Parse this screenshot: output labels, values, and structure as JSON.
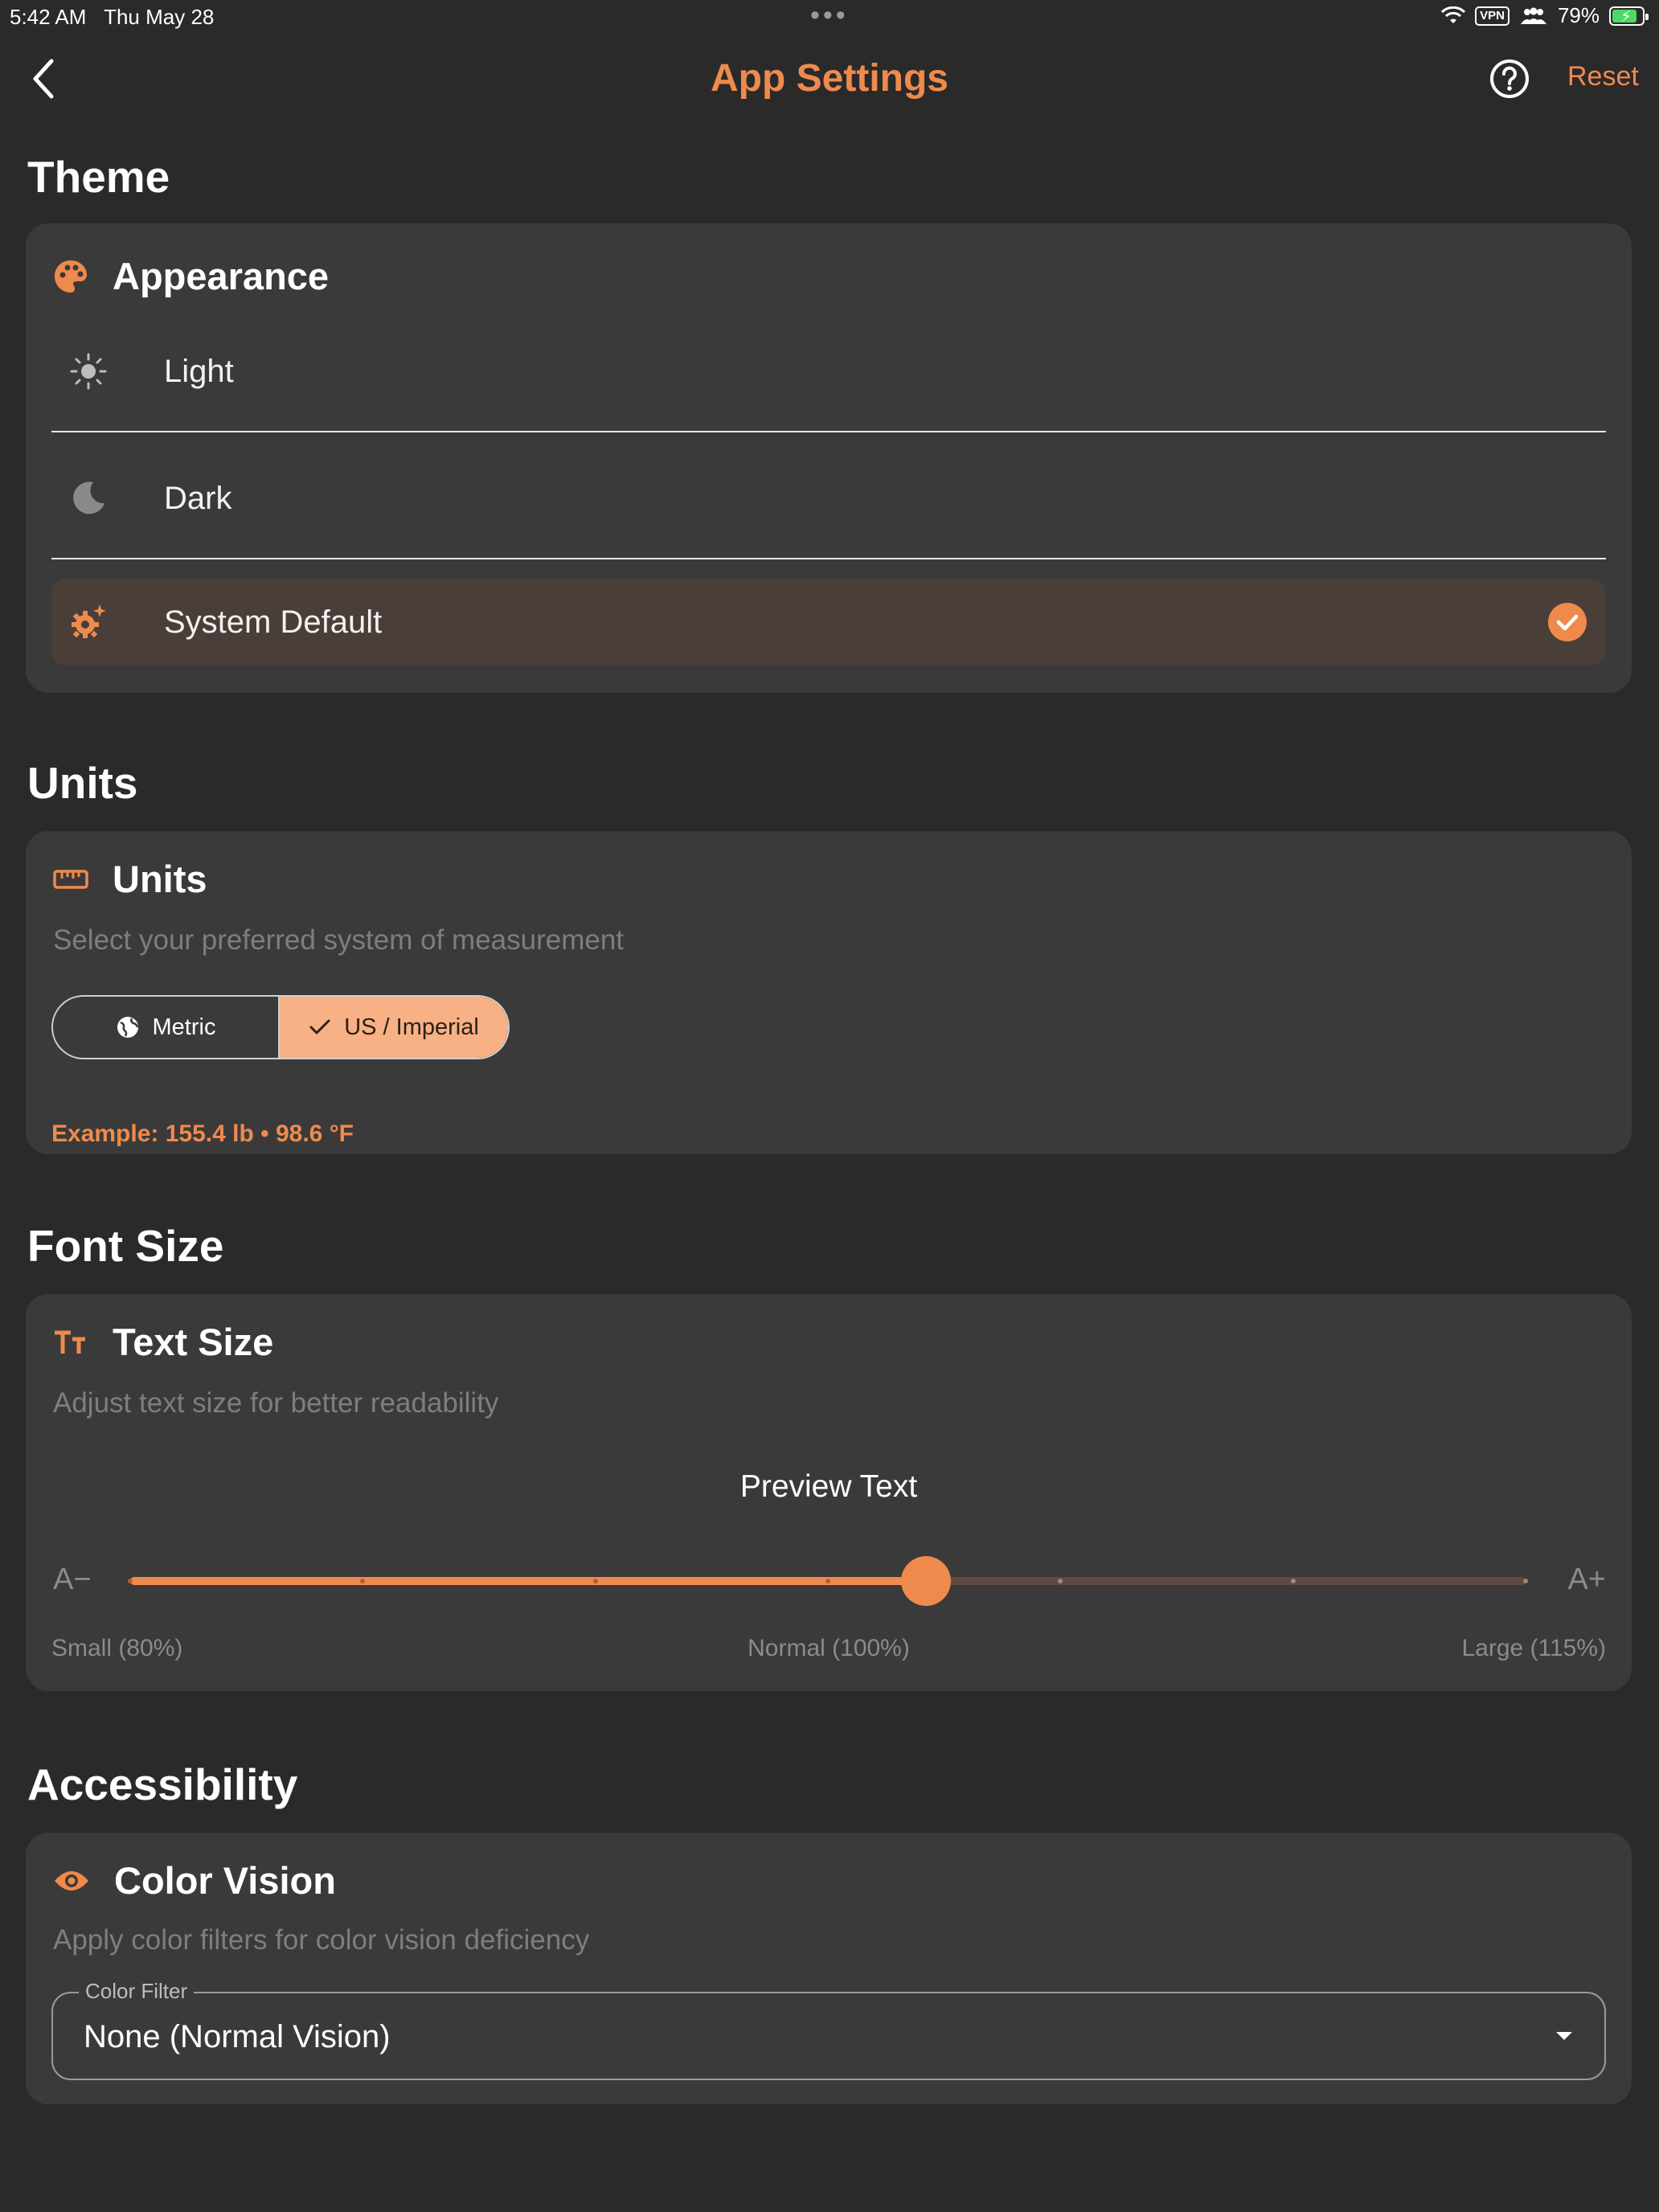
{
  "status_bar": {
    "time": "5:42 AM",
    "date": "Thu May 28",
    "dots": "•••",
    "vpn": "VPN",
    "battery": "79%"
  },
  "nav": {
    "title": "App Settings",
    "reset_label": "Reset",
    "icons": {
      "back": "chevron-left-icon",
      "help": "question-circle-icon"
    }
  },
  "theme": {
    "section_title": "Theme",
    "card_title": "Appearance",
    "card_icon": "palette-icon",
    "options": [
      {
        "label": "Light",
        "icon": "sun-icon",
        "selected": false
      },
      {
        "label": "Dark",
        "icon": "moon-icon",
        "selected": false
      },
      {
        "label": "System Default",
        "icon": "gear-sparkle-icon",
        "selected": true
      }
    ]
  },
  "units": {
    "section_title": "Units",
    "card_title": "Units",
    "card_icon": "ruler-icon",
    "description": "Select your preferred system of measurement",
    "options": [
      {
        "label": "Metric",
        "icon": "globe-icon",
        "selected": false
      },
      {
        "label": "US / Imperial",
        "icon": "check-icon",
        "selected": true
      }
    ],
    "example": "Example: 155.4 lb • 98.6 °F"
  },
  "font_size": {
    "section_title": "Font Size",
    "card_title": "Text Size",
    "card_icon": "text-size-icon",
    "description": "Adjust text size for better readability",
    "preview": "Preview Text",
    "min_label": "A−",
    "max_label": "A+",
    "scale_small": "Small (80%)",
    "scale_normal": "Normal (100%)",
    "scale_large": "Large (115%)",
    "slider_value_fraction": 0.57,
    "tick_fractions": [
      0,
      0.1667,
      0.3333,
      0.5,
      0.6667,
      0.8333,
      1
    ]
  },
  "accessibility": {
    "section_title": "Accessibility",
    "card_title": "Color Vision",
    "card_icon": "eye-icon",
    "description": "Apply color filters for color vision deficiency",
    "filter_label": "Color Filter",
    "filter_value": "None (Normal Vision)"
  },
  "colors": {
    "accent": "#ef8a4d",
    "accent_light": "#f7b184",
    "background": "#2a2a2b",
    "card": "#3a3a3a",
    "selected_row": "#4a3e39",
    "battery_green": "#4cd964"
  }
}
